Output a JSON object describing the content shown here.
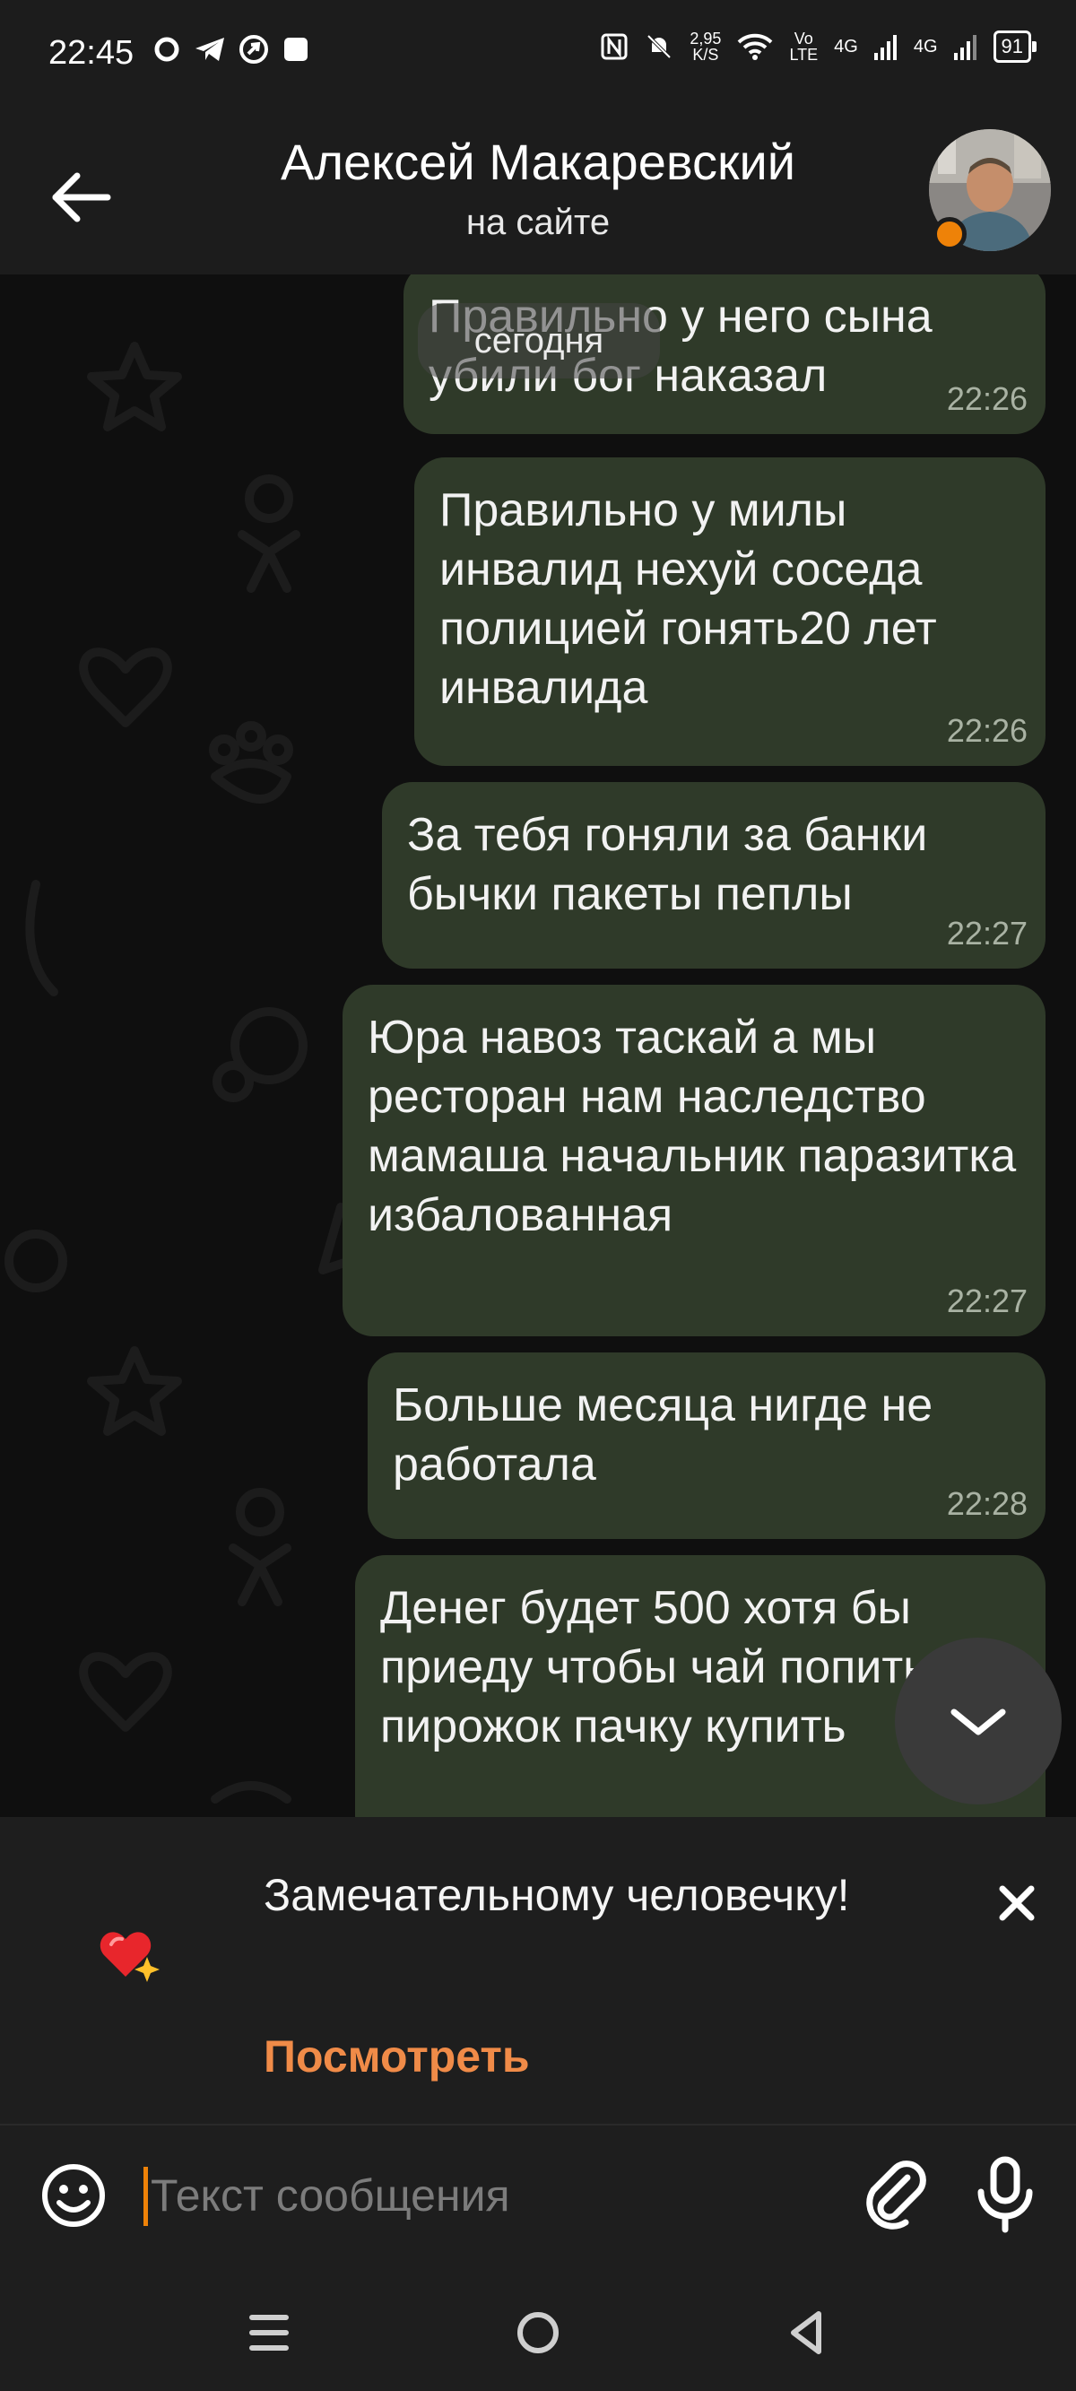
{
  "status_bar": {
    "time": "22:45",
    "network_speed_value": "2,95",
    "network_speed_unit": "K/S",
    "volte_top": "Vo",
    "volte_bottom": "LTE",
    "net1": "4G",
    "net2": "4G",
    "battery": "91"
  },
  "header": {
    "contact_name": "Алексей Макаревский",
    "contact_status": "на сайте",
    "online_color": "#ee8208"
  },
  "chat": {
    "date_chip": "сегодня",
    "messages": [
      {
        "text": "Правильно у него сына убили бог наказал",
        "time": "22:26"
      },
      {
        "text": "Правильно у милы инвалид нехуй соседа полицией гонять20 лет инвалида",
        "time": "22:26"
      },
      {
        "text": "За тебя гоняли за банки бычки пакеты пеплы",
        "time": "22:27"
      },
      {
        "text": "Юра навоз таскай а мы ресторан нам наследство мамаша начальник паразитка избалованная",
        "time": "22:27"
      },
      {
        "text": "Больше месяца нигде не работала",
        "time": "22:28"
      },
      {
        "text": "Денег будет 500 хотя бы приеду чтобы чай попить пирожок пачку купить",
        "time": ""
      }
    ],
    "bubble_color": "#2f3a29"
  },
  "promo": {
    "text": "Замечательному человечку!",
    "link": "Посмотреть",
    "accent": "#f08b48"
  },
  "composer": {
    "placeholder": "Текст сообщения"
  },
  "icons": [
    "back-arrow-icon",
    "chevron-down-icon",
    "close-icon",
    "heart-sparkle-icon",
    "smiley-icon",
    "paperclip-icon",
    "microphone-icon",
    "menu-icon",
    "home-circle-icon",
    "back-triangle-icon"
  ]
}
